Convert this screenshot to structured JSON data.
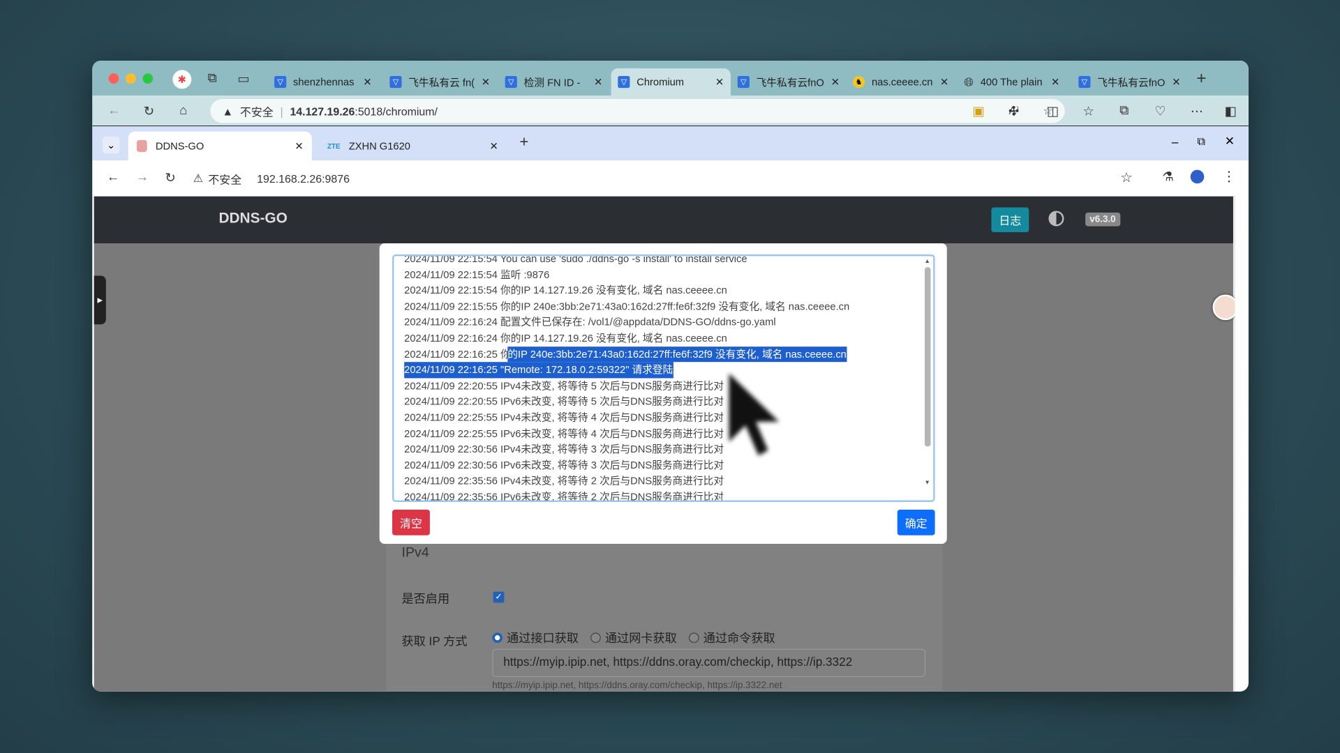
{
  "outer_browser": {
    "tabs": [
      {
        "label": "shenzhennas",
        "active": false
      },
      {
        "label": "飞牛私有云 fn(",
        "active": false
      },
      {
        "label": "检测 FN ID - ",
        "active": false
      },
      {
        "label": "Chromium",
        "active": true
      },
      {
        "label": "飞牛私有云fnO",
        "active": false
      },
      {
        "label": "nas.ceeee.cn",
        "active": false
      },
      {
        "label": "400 The plain",
        "active": false
      },
      {
        "label": "飞牛私有云fnO",
        "active": false
      }
    ],
    "security_label": "不安全",
    "url_host": "14.127.19.26",
    "url_rest": ":5018/chromium/"
  },
  "inner_browser": {
    "tabs": [
      {
        "label": "DDNS-GO",
        "active": true
      },
      {
        "label": "ZXHN G1620",
        "active": false,
        "favicon": "ZTE"
      }
    ],
    "security_label": "不安全",
    "url": "192.168.2.26:9876"
  },
  "app": {
    "title": "DDNS-GO",
    "log_button": "日志",
    "version": "v6.3.0",
    "accent": "#17a2b8"
  },
  "log_modal": {
    "lines": [
      "2024/11/09 22:15:54 You can use 'sudo ./ddns-go -s install' to install service",
      "2024/11/09 22:15:54 监听 :9876",
      "2024/11/09 22:15:54 你的IP 14.127.19.26 没有变化, 域名 nas.ceeee.cn",
      "2024/11/09 22:15:55 你的IP 240e:3bb:2e71:43a0:162d:27ff:fe6f:32f9 没有变化, 域名 nas.ceeee.cn",
      "2024/11/09 22:16:24 配置文件已保存在: /vol1/@appdata/DDNS-GO/ddns-go.yaml",
      "2024/11/09 22:16:24 你的IP 14.127.19.26 没有变化, 域名 nas.ceeee.cn",
      "2024/11/09 22:16:25 你",
      "的IP 240e:3bb:2e71:43a0:162d:27ff:fe6f:32f9 没有变化, 域名 nas.ceeee.cn",
      "2024/11/09 22:16:25 \"Remote: 172.18.0.2:59322\" 请求登陆",
      "2024/11/09 22:20:55 IPv4未改变, 将等待 5 次后与DNS服务商进行比对",
      "2024/11/09 22:20:55 IPv6未改变, 将等待 5 次后与DNS服务商进行比对",
      "2024/11/09 22:25:55 IPv4未改变, 将等待 4 次后与DNS服务商进行比对",
      "2024/11/09 22:25:55 IPv6未改变, 将等待 4 次后与DNS服务商进行比对",
      "2024/11/09 22:30:56 IPv4未改变, 将等待 3 次后与DNS服务商进行比对",
      "2024/11/09 22:30:56 IPv6未改变, 将等待 3 次后与DNS服务商进行比对",
      "2024/11/09 22:35:56 IPv4未改变, 将等待 2 次后与DNS服务商进行比对",
      "2024/11/09 22:35:56 IPv6未改变, 将等待 2 次后与DNS服务商进行比对"
    ],
    "clear_button": "清空",
    "ok_button": "确定"
  },
  "form": {
    "section": "IPv4",
    "enable_label": "是否启用",
    "enabled": true,
    "ip_method_label": "获取 IP 方式",
    "ip_methods": [
      "通过接口获取",
      "通过网卡获取",
      "通过命令获取"
    ],
    "ip_method_selected": 0,
    "url_value": "https://myip.ipip.net, https://ddns.oray.com/checkip, https://ip.3322",
    "url_hint": "https://myip.ipip.net, https://ddns.oray.com/checkip, https://ip.3322.net"
  }
}
